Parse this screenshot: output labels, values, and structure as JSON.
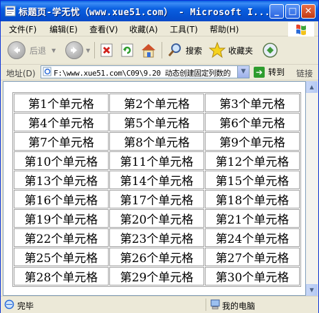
{
  "window": {
    "title": "标题页-学无忧（www.xue51.com） - Microsoft I...",
    "controls": {
      "minimize": "_",
      "maximize": "□",
      "close": "✕"
    }
  },
  "menu": [
    "文件(F)",
    "编辑(E)",
    "查看(V)",
    "收藏(A)",
    "工具(T)",
    "帮助(H)"
  ],
  "toolbar": {
    "back_label": "后退",
    "search_label": "搜索",
    "favorites_label": "收藏夹"
  },
  "address": {
    "label": "地址(D)",
    "value": "F:\\www.xue51.com\\C09\\9.20  动态创建固定列数的",
    "go_label": "转到",
    "links_label": "链接"
  },
  "table": {
    "rows": [
      [
        "第1个单元格",
        "第2个单元格",
        "第3个单元格"
      ],
      [
        "第4个单元格",
        "第5个单元格",
        "第6个单元格"
      ],
      [
        "第7个单元格",
        "第8个单元格",
        "第9个单元格"
      ],
      [
        "第10个单元格",
        "第11个单元格",
        "第12个单元格"
      ],
      [
        "第13个单元格",
        "第14个单元格",
        "第15个单元格"
      ],
      [
        "第16个单元格",
        "第17个单元格",
        "第18个单元格"
      ],
      [
        "第19个单元格",
        "第20个单元格",
        "第21个单元格"
      ],
      [
        "第22个单元格",
        "第23个单元格",
        "第24个单元格"
      ],
      [
        "第25个单元格",
        "第26个单元格",
        "第27个单元格"
      ],
      [
        "第28个单元格",
        "第29个单元格",
        "第30个单元格"
      ]
    ]
  },
  "status": {
    "text": "完毕",
    "zone": "我的电脑"
  },
  "colors": {
    "titlebar": "#0A5FE0",
    "chrome": "#ECE9D8",
    "go_green": "#2E9C2E"
  }
}
